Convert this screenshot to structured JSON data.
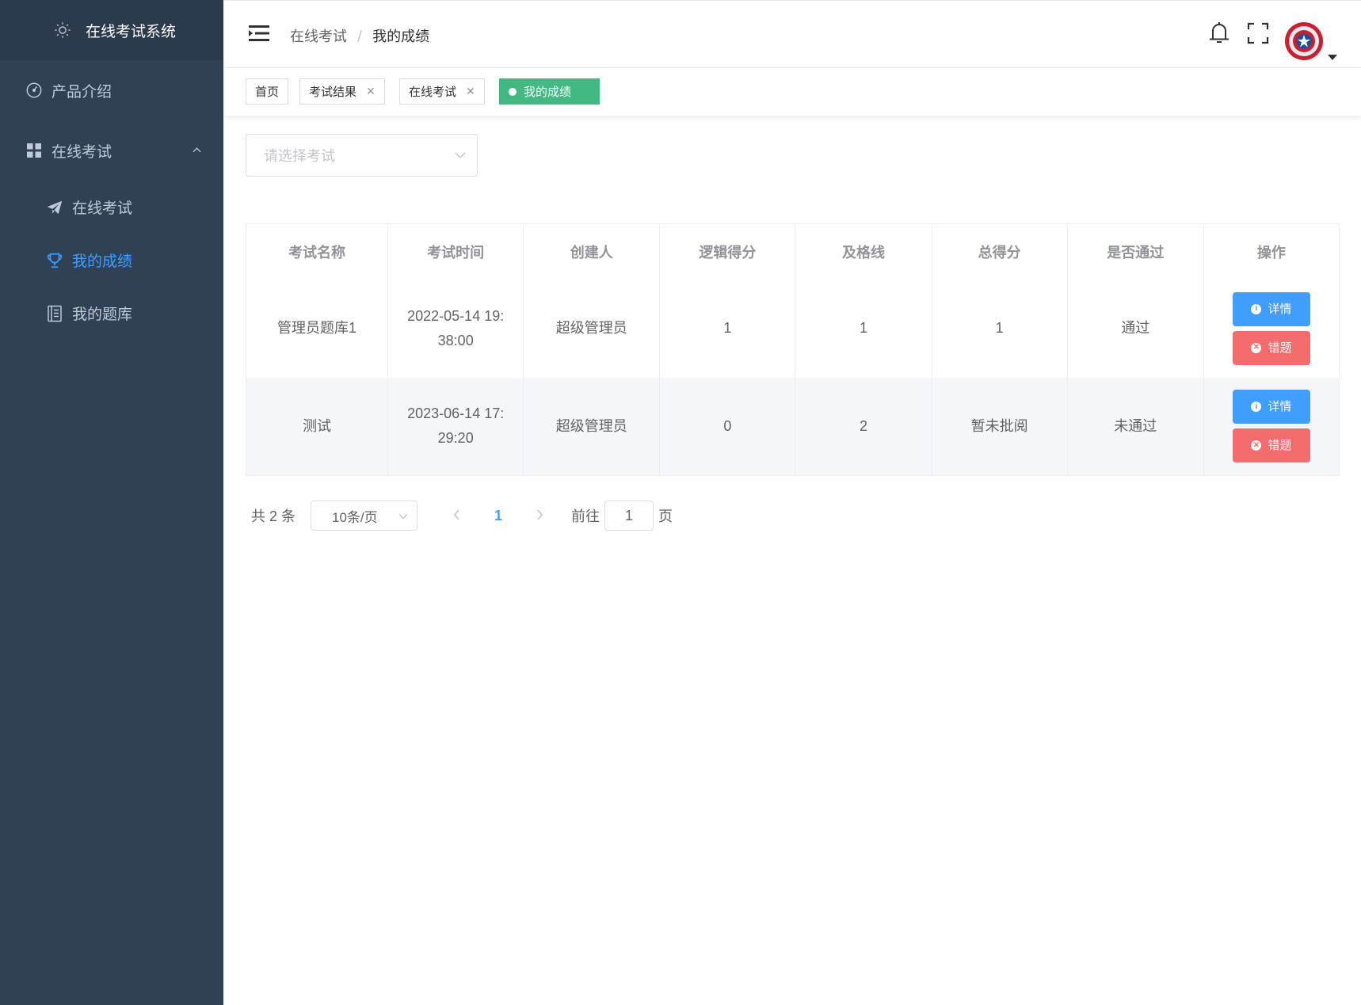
{
  "app": {
    "title": "在线考试系统"
  },
  "sidebar": {
    "items": [
      {
        "label": "产品介绍",
        "icon": "dashboard-gauge-icon"
      },
      {
        "label": "在线考试",
        "icon": "grid-icon",
        "expanded": true,
        "children": [
          {
            "label": "在线考试",
            "icon": "paper-plane-icon"
          },
          {
            "label": "我的成绩",
            "icon": "trophy-icon",
            "active": true
          },
          {
            "label": "我的题库",
            "icon": "notebook-icon"
          }
        ]
      }
    ]
  },
  "header": {
    "breadcrumb": [
      "在线考试",
      "我的成绩"
    ],
    "separator": "/"
  },
  "tags": [
    {
      "label": "首页",
      "closable": false
    },
    {
      "label": "考试结果",
      "closable": true
    },
    {
      "label": "在线考试",
      "closable": true
    },
    {
      "label": "我的成绩",
      "closable": true,
      "active": true
    }
  ],
  "filter": {
    "placeholder": "请选择考试"
  },
  "table": {
    "columns": [
      "考试名称",
      "考试时间",
      "创建人",
      "逻辑得分",
      "及格线",
      "总得分",
      "是否通过",
      "操作"
    ],
    "rows": [
      {
        "name": "管理员题库1",
        "time_line1": "2022-05-14 19:",
        "time_line2": "38:00",
        "creator": "超级管理员",
        "logic_score": "1",
        "pass_line": "1",
        "total": "1",
        "status": "通过",
        "status_type": "pass"
      },
      {
        "name": "测试",
        "time_line1": "2023-06-14 17:",
        "time_line2": "29:20",
        "creator": "超级管理员",
        "logic_score": "0",
        "pass_line": "2",
        "total": "暂未批阅",
        "status": "未通过",
        "status_type": "fail"
      }
    ],
    "actions": {
      "detail": "详情",
      "wrong": "错题"
    }
  },
  "pagination": {
    "total_text": "共 2 条",
    "page_size": "10条/页",
    "current_page": "1",
    "goto_prefix": "前往",
    "goto_value": "1",
    "goto_suffix": "页"
  },
  "colors": {
    "sidebar_bg": "#304156",
    "active": "#409eff",
    "tag_active": "#42b983",
    "pass": "#67c23a",
    "fail": "#f56c6c"
  }
}
